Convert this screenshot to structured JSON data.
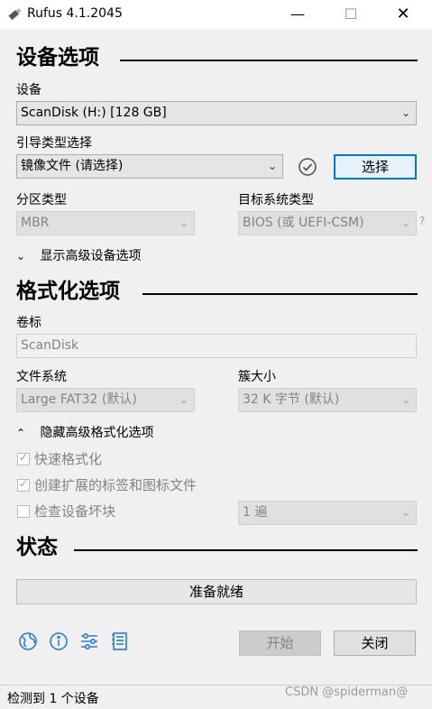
{
  "window": {
    "title": "Rufus 4.1.2045",
    "minimize": "—",
    "maximize": "☐",
    "close": "✕"
  },
  "device_section": {
    "header": "设备选项",
    "device_label": "设备",
    "device_value": "ScanDisk (H:) [128 GB]",
    "boot_label": "引导类型选择",
    "boot_value": "镜像文件 (请选择)",
    "select_button": "选择",
    "partition_label": "分区类型",
    "partition_value": "MBR",
    "target_label": "目标系统类型",
    "target_value": "BIOS (或 UEFI-CSM)",
    "target_help": "?",
    "advanced_toggle": "显示高级设备选项"
  },
  "format_section": {
    "header": "格式化选项",
    "volume_label": "卷标",
    "volume_value": "ScanDisk",
    "fs_label": "文件系统",
    "fs_value": "Large FAT32 (默认)",
    "cluster_label": "簇大小",
    "cluster_value": "32 K 字节 (默认)",
    "advanced_toggle": "隐藏高级格式化选项",
    "quick_format": "快速格式化",
    "extended_label": "创建扩展的标签和图标文件",
    "bad_blocks": "检查设备坏块",
    "passes_value": "1 遍"
  },
  "status_section": {
    "header": "状态",
    "progress_text": "准备就绪",
    "progress": 0
  },
  "actions": {
    "start": "开始",
    "close": "关闭"
  },
  "statusbar": {
    "text": "检测到 1 个设备",
    "watermark": "CSDN @spiderman@"
  },
  "icons": [
    "globe-icon",
    "info-icon",
    "settings-sliders-icon",
    "log-icon"
  ],
  "colors": {
    "accent": "#0078d7",
    "icon_blue": "#2b7cd3"
  }
}
